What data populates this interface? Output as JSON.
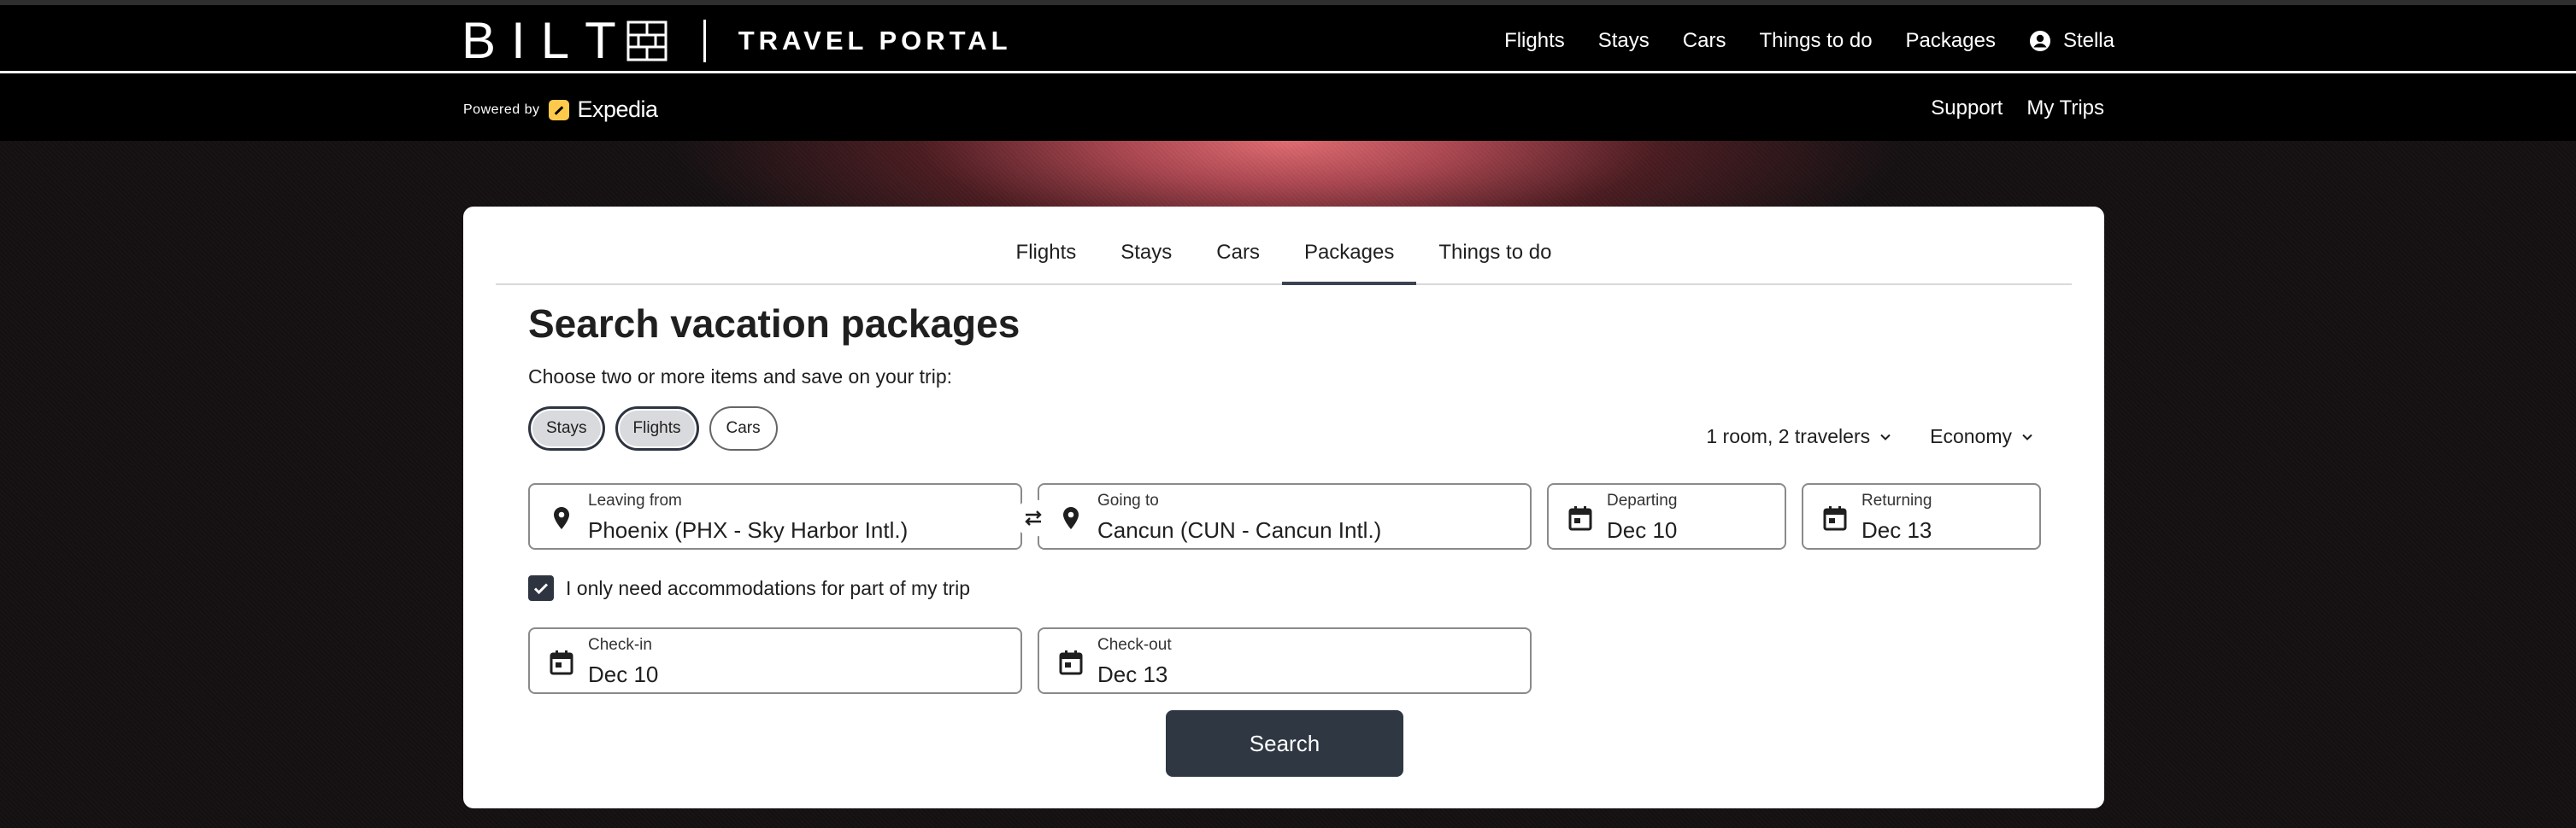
{
  "header": {
    "logo_word": [
      "B",
      "I",
      "L",
      "T"
    ],
    "logo_product": "TRAVEL PORTAL",
    "nav": [
      {
        "label": "Flights"
      },
      {
        "label": "Stays"
      },
      {
        "label": "Cars"
      },
      {
        "label": "Things to do"
      },
      {
        "label": "Packages"
      }
    ],
    "user_name": "Stella"
  },
  "subbar": {
    "powered_by": "Powered by",
    "partner": "Expedia",
    "links": [
      {
        "label": "Support"
      },
      {
        "label": "My Trips"
      }
    ]
  },
  "card": {
    "tabs": [
      {
        "label": "Flights"
      },
      {
        "label": "Stays"
      },
      {
        "label": "Cars"
      },
      {
        "label": "Packages",
        "active": true
      },
      {
        "label": "Things to do"
      }
    ],
    "title": "Search vacation packages",
    "subtitle": "Choose two or more items and save on your trip:",
    "chips": [
      {
        "label": "Stays",
        "selected": true
      },
      {
        "label": "Flights",
        "selected": true
      },
      {
        "label": "Cars",
        "selected": false
      }
    ],
    "travelers": "1 room, 2 travelers",
    "cabin_class": "Economy",
    "leaving_from": {
      "label": "Leaving from",
      "value": "Phoenix (PHX - Sky Harbor Intl.)"
    },
    "going_to": {
      "label": "Going to",
      "value": "Cancun (CUN - Cancun Intl.)"
    },
    "departing": {
      "label": "Departing",
      "value": "Dec 10"
    },
    "returning": {
      "label": "Returning",
      "value": "Dec 13"
    },
    "partial_stay": {
      "label": "I only need accommodations for part of my trip",
      "checked": true
    },
    "check_in": {
      "label": "Check-in",
      "value": "Dec 10"
    },
    "check_out": {
      "label": "Check-out",
      "value": "Dec 13"
    },
    "search_label": "Search"
  },
  "colors": {
    "header_bg": "#000000",
    "accent_dark": "#2f3742",
    "expedia_yellow": "#ffc94c",
    "hero_glow": "#e06b72"
  }
}
